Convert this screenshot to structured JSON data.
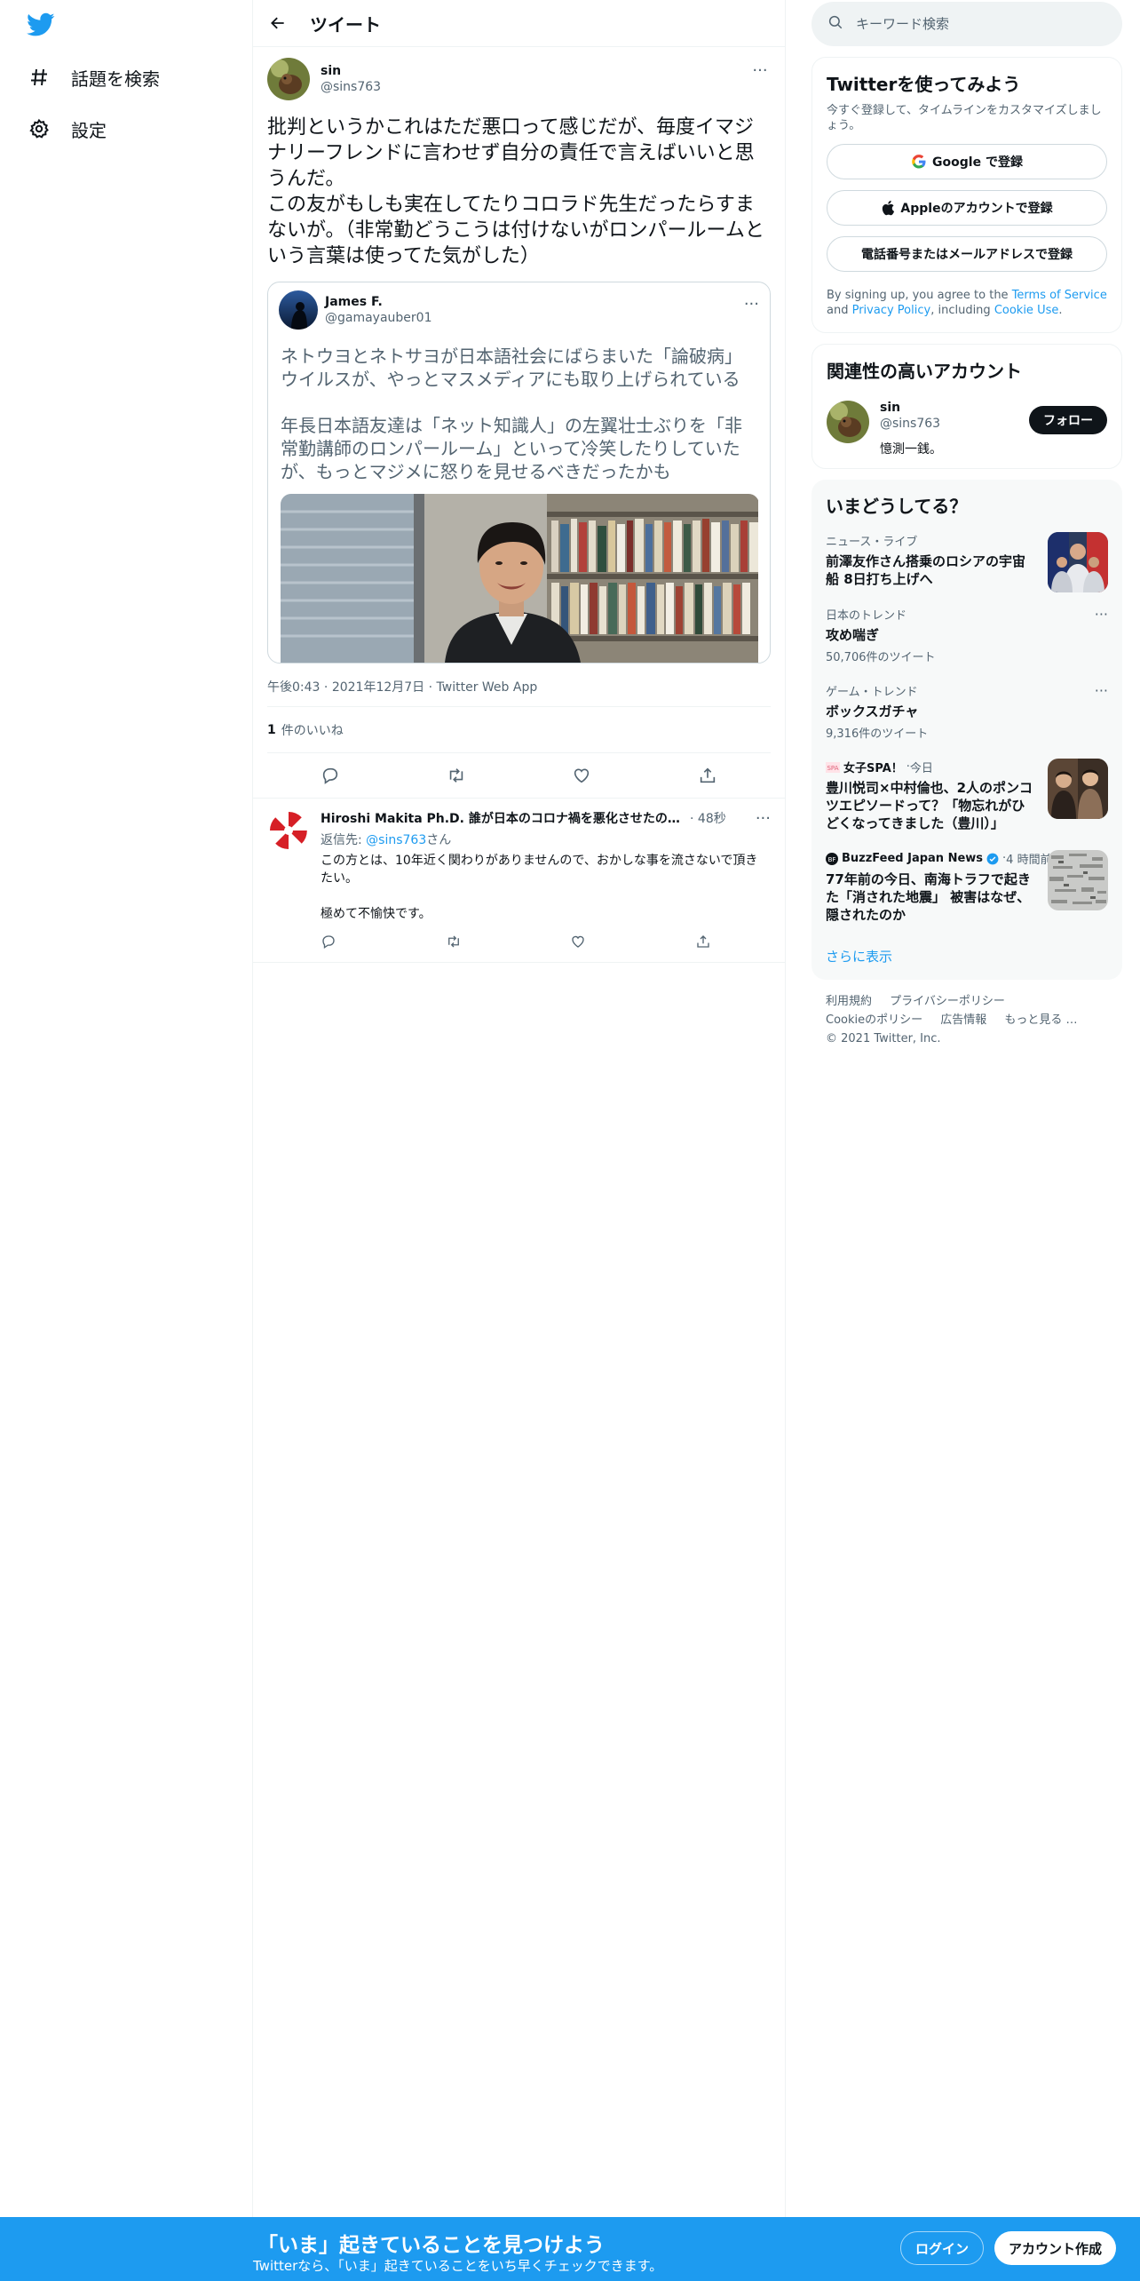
{
  "nav": {
    "logo": "twitter-bird-icon",
    "explore": "話題を検索",
    "settings": "設定"
  },
  "header": {
    "title": "ツイート"
  },
  "tweet": {
    "name": "sin",
    "handle": "@sins763",
    "text": "批判というかこれはただ悪口って感じだが、毎度イマジナリーフレンドに言わせず自分の責任で言えばいいと思うんだ。\nこの友がもしも実在してたりコロラド先生だったらすまないが。（非常勤どうこうは付けないがロンパールームという言葉は使ってた気がした）",
    "quote": {
      "name": "James F.",
      "handle": "@gamayauber01",
      "text": "ネトウヨとネトサヨが日本語社会にばらまいた「論破病」ウイルスが、やっとマスメディアにも取り上げられている\n\n年長日本語友達は「ネット知識人」の左翼壮士ぶりを「非常勤講師のロンパールーム」といって冷笑したりしていたが、もっとマジメに怒りを見せるべきだったかも"
    },
    "time": "午後0:43",
    "date": "2021年12月7日",
    "source": "Twitter Web App",
    "like_count": "1",
    "like_label": "件のいいね"
  },
  "reply": {
    "name": "Hiroshi Makita Ph.D. 誰が日本のコロナ禍を悪化させたのか?",
    "time": "48秒",
    "reply_prefix": "返信先: ",
    "mention": "@sins763",
    "reply_suffix": "さん",
    "text": "この方とは、10年近く関わりがありませんので、おかしな事を流さないで頂きたい。\n\n極めて不愉快です。"
  },
  "search": {
    "placeholder": "キーワード検索"
  },
  "signup": {
    "title": "Twitterを使ってみよう",
    "subtitle": "今すぐ登録して、タイムラインをカスタマイズしましょう。",
    "google": "Google で登録",
    "apple": "Appleのアカウントで登録",
    "phone": "電話番号またはメールアドレスで登録",
    "terms_prefix": "By signing up, you agree to the ",
    "terms_link": "Terms of Service",
    "terms_and": " and ",
    "privacy_link": "Privacy Policy",
    "terms_including": ", including ",
    "cookie_link": "Cookie Use",
    "terms_end": "."
  },
  "related": {
    "title": "関連性の高いアカウント",
    "name": "sin",
    "handle": "@sins763",
    "bio": "憶測一銭。",
    "follow": "フォロー"
  },
  "trends": {
    "title": "いまどうしてる？",
    "items": [
      {
        "category": "ニュース・ライブ",
        "title": "前澤友作さん搭乗のロシアの宇宙船 8日打ち上げへ",
        "count": ""
      },
      {
        "category": "日本のトレンド",
        "title": "攻め喘ぎ",
        "count": "50,706件のツイート"
      },
      {
        "category": "ゲーム・トレンド",
        "title": "ボックスガチャ",
        "count": "9,316件のツイート"
      },
      {
        "category_source": "女子SPA！",
        "category_time": "今日",
        "title": "豊川悦司×中村倫也、2人のポンコツエピソードって？「物忘れがひどくなってきました（豊川）」",
        "count": ""
      },
      {
        "category_source": "BuzzFeed Japan News",
        "category_time": "4 時間前",
        "title": "77年前の今日、南海トラフで起きた「消された地震」 被害はなぜ、隠されたのか",
        "count": ""
      }
    ],
    "show_more": "さらに表示"
  },
  "footer": {
    "terms": "利用規約",
    "privacy": "プライバシーポリシー",
    "cookie": "Cookieのポリシー",
    "ads": "広告情報",
    "more": "もっと見る …",
    "copyright": "© 2021 Twitter, Inc."
  },
  "bottom": {
    "title": "「いま」起きていることを見つけよう",
    "subtitle": "Twitterなら、「いま」起きていることをいち早くチェックできます。",
    "login": "ログイン",
    "signup": "アカウント作成"
  },
  "colors": {
    "accent": "#1d9bf0",
    "text": "#0f1419",
    "secondary": "#536471",
    "border": "#eff3f4"
  }
}
